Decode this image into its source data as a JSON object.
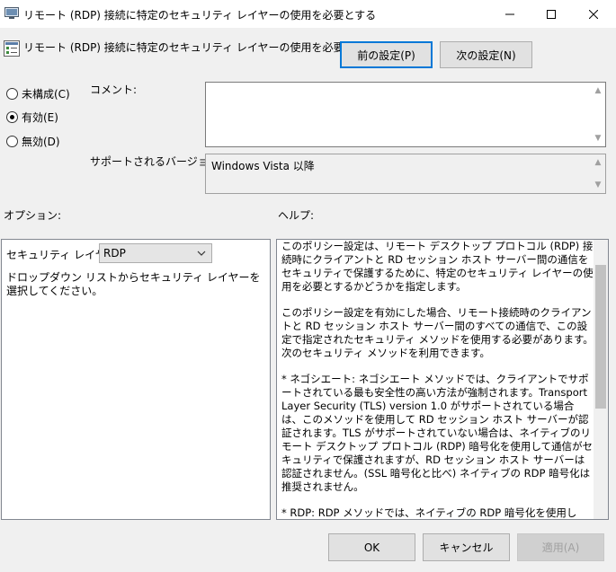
{
  "window": {
    "title": "リモート (RDP) 接続に特定のセキュリティ レイヤーの使用を必要とする",
    "minimize_icon": "minimize-icon",
    "maximize_icon": "maximize-icon",
    "close_icon": "close-icon"
  },
  "header": {
    "policy_title": "リモート (RDP) 接続に特定のセキュリティ レイヤーの使用を必要とする",
    "prev_button": "前の設定(P)",
    "next_button": "次の設定(N)"
  },
  "state": {
    "options": [
      {
        "label": "未構成(C)",
        "checked": false
      },
      {
        "label": "有効(E)",
        "checked": true
      },
      {
        "label": "無効(D)",
        "checked": false
      }
    ]
  },
  "comment": {
    "label": "コメント:",
    "value": ""
  },
  "supported": {
    "label": "サポートされるバージョン:",
    "value": "Windows Vista 以降"
  },
  "options_section": {
    "label": "オプション:",
    "security_layer_label": "セキュリティ レイヤー",
    "security_layer_value": "RDP",
    "description": "ドロップダウン リストからセキュリティ レイヤーを選択してください。"
  },
  "help_section": {
    "label": "ヘルプ:",
    "paragraphs": [
      "このポリシー設定は、リモート デスクトップ プロトコル (RDP) 接続時にクライアントと RD セッション ホスト サーバー間の通信をセキュリティで保護するために、特定のセキュリティ レイヤーの使用を必要とするかどうかを指定します。",
      "このポリシー設定を有効にした場合、リモート接続時のクライアントと RD セッション ホスト サーバー間のすべての通信で、この設定で指定されたセキュリティ メソッドを使用する必要があります。次のセキュリティ メソッドを利用できます。",
      "* ネゴシエート: ネゴシエート メソッドでは、クライアントでサポートされている最も安全性の高い方法が強制されます。Transport Layer Security (TLS) version 1.0 がサポートされている場合は、このメソッドを使用して RD セッション ホスト サーバーが認証されます。TLS がサポートされていない場合は、ネイティブのリモート デスクトップ プロトコル (RDP) 暗号化を使用して通信がセキュリティで保護されますが、RD セッション ホスト サーバーは認証されません。(SSL 暗号化と比べ) ネイティブの RDP 暗号化は推奨されません。",
      "* RDP: RDP メソッドでは、ネイティブの RDP 暗号化を使用して、クライアントと RD セッション ホスト サーバー間の通信がセキュリティで保護されます。"
    ]
  },
  "footer": {
    "ok": "OK",
    "cancel": "キャンセル",
    "apply": "適用(A)"
  }
}
